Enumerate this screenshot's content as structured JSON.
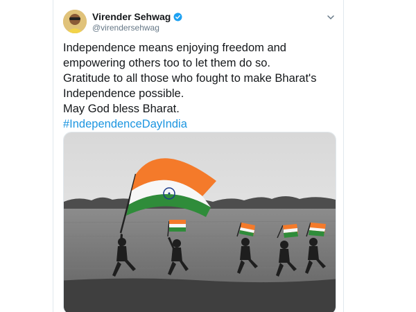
{
  "user": {
    "display_name": "Virender Sehwag",
    "handle": "@virendersehwag",
    "verified": true
  },
  "icons": {
    "verified": "verified-badge-icon",
    "menu": "chevron-down-icon"
  },
  "tweet": {
    "lines": [
      "Independence means enjoying freedom and",
      "empowering others too to let them do so.",
      "Gratitude to all those who fought to make Bharat's",
      "Independence possible.",
      "May God bless Bharat."
    ],
    "hashtag": "#IndependenceDayIndia"
  },
  "colors": {
    "link": "#1b95e0",
    "verified": "#1da1f2",
    "saffron": "#f47a2a",
    "green": "#2f8c3a",
    "chakra": "#1a3a8a"
  }
}
